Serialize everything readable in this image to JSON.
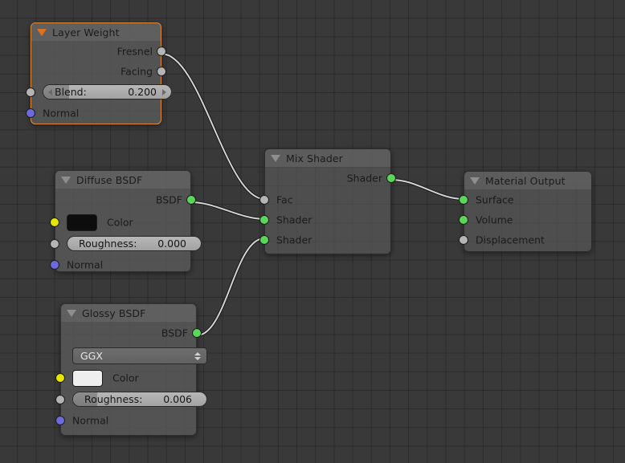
{
  "app": {
    "editor": "blender-shader-node-editor",
    "background_color": "#393939",
    "grid_color": "#303030",
    "wire_color": "#cfcfcf",
    "selected_outline_color": "#e08a36"
  },
  "socket_colors": {
    "shader": "#5ad65a",
    "value": "#b4b4b4",
    "color": "#e6e600",
    "vector": "#6b6bdb"
  },
  "nodes": [
    {
      "id": "layer-weight",
      "title": "Layer Weight",
      "selected": true,
      "collapse_icon": "triangle-down-icon",
      "outputs": [
        {
          "label": "Fresnel",
          "socket": "value"
        },
        {
          "label": "Facing",
          "socket": "value"
        }
      ],
      "widgets": [
        {
          "type": "slider",
          "label": "Blend:",
          "value": "0.200",
          "fill_percent": 20,
          "left_icon": "arrow-left-icon",
          "right_icon": "arrow-right-icon"
        }
      ],
      "inputs": [
        {
          "label": "",
          "socket": "value"
        },
        {
          "label": "Normal",
          "socket": "vector"
        }
      ]
    },
    {
      "id": "diffuse-bsdf",
      "title": "Diffuse BSDF",
      "selected": false,
      "collapse_icon": "triangle-down-icon",
      "outputs": [
        {
          "label": "BSDF",
          "socket": "shader"
        }
      ],
      "widgets": [
        {
          "type": "color",
          "label": "Color",
          "value": "#0d0d0d",
          "socket": "color"
        },
        {
          "type": "slider",
          "label": "Roughness:",
          "value": "0.000",
          "fill_percent": 0,
          "socket": "value"
        }
      ],
      "inputs": [
        {
          "label": "Normal",
          "socket": "vector"
        }
      ]
    },
    {
      "id": "glossy-bsdf",
      "title": "Glossy BSDF",
      "selected": false,
      "collapse_icon": "triangle-down-icon",
      "outputs": [
        {
          "label": "BSDF",
          "socket": "shader"
        }
      ],
      "widgets": [
        {
          "type": "dropdown",
          "value": "GGX",
          "icon": "updown-arrows-icon"
        },
        {
          "type": "color",
          "label": "Color",
          "value": "#eeeeee",
          "socket": "color"
        },
        {
          "type": "slider",
          "label": "Roughness:",
          "value": "0.006",
          "fill_percent": 18,
          "socket": "value"
        }
      ],
      "inputs": [
        {
          "label": "Normal",
          "socket": "vector"
        }
      ]
    },
    {
      "id": "mix-shader",
      "title": "Mix Shader",
      "selected": false,
      "collapse_icon": "triangle-down-icon",
      "outputs": [
        {
          "label": "Shader",
          "socket": "shader"
        }
      ],
      "inputs": [
        {
          "label": "Fac",
          "socket": "value"
        },
        {
          "label": "Shader",
          "socket": "shader"
        },
        {
          "label": "Shader",
          "socket": "shader"
        }
      ]
    },
    {
      "id": "material-output",
      "title": "Material Output",
      "selected": false,
      "collapse_icon": "triangle-down-icon",
      "inputs": [
        {
          "label": "Surface",
          "socket": "shader"
        },
        {
          "label": "Volume",
          "socket": "shader"
        },
        {
          "label": "Displacement",
          "socket": "value"
        }
      ]
    }
  ],
  "links": [
    {
      "from": "layer-weight.Fresnel",
      "to": "mix-shader.Fac"
    },
    {
      "from": "diffuse-bsdf.BSDF",
      "to": "mix-shader.Shader1"
    },
    {
      "from": "glossy-bsdf.BSDF",
      "to": "mix-shader.Shader2"
    },
    {
      "from": "mix-shader.Shader",
      "to": "material-output.Surface"
    }
  ],
  "labels": {
    "layer_weight": {
      "title": "Layer Weight",
      "fresnel": "Fresnel",
      "facing": "Facing",
      "blend_label": "Blend:",
      "blend_value": "0.200",
      "normal": "Normal"
    },
    "diffuse": {
      "title": "Diffuse BSDF",
      "bsdf": "BSDF",
      "color": "Color",
      "roughness_label": "Roughness:",
      "roughness_value": "0.000",
      "normal": "Normal"
    },
    "glossy": {
      "title": "Glossy BSDF",
      "bsdf": "BSDF",
      "distribution": "GGX",
      "color": "Color",
      "roughness_label": "Roughness:",
      "roughness_value": "0.006",
      "normal": "Normal"
    },
    "mix": {
      "title": "Mix Shader",
      "shader_out": "Shader",
      "fac": "Fac",
      "shader1": "Shader",
      "shader2": "Shader"
    },
    "output": {
      "title": "Material Output",
      "surface": "Surface",
      "volume": "Volume",
      "displacement": "Displacement"
    }
  }
}
